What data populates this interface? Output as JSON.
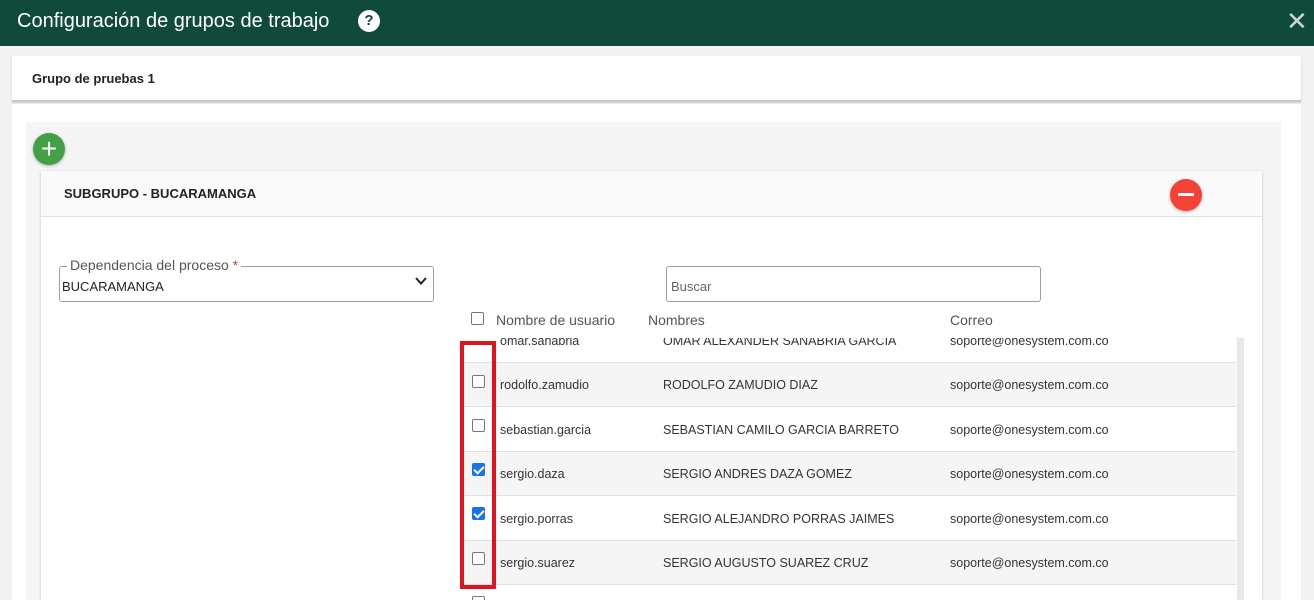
{
  "window": {
    "title": "Configuración de grupos de trabajo",
    "help_glyph": "?",
    "close_glyph": "✕"
  },
  "group": {
    "title": "Grupo de pruebas 1"
  },
  "add_glyph": "+",
  "subgroup": {
    "title": "SUBGRUPO - BUCARAMANGA",
    "dependency": {
      "label": "Dependencia del proceso",
      "required_mark": "*",
      "value": "BUCARAMANGA"
    },
    "search": {
      "placeholder": "Buscar"
    },
    "table": {
      "columns": [
        "Nombre de usuario",
        "Nombres",
        "Correo"
      ],
      "rows": [
        {
          "user": "omar.sanabria",
          "name": "OMAR ALEXANDER SANABRIA GARCIA",
          "email": "soporte@onesystem.com.co",
          "checked": false
        },
        {
          "user": "rodolfo.zamudio",
          "name": "RODOLFO ZAMUDIO DIAZ",
          "email": "soporte@onesystem.com.co",
          "checked": false
        },
        {
          "user": "sebastian.garcia",
          "name": "SEBASTIAN CAMILO GARCIA BARRETO",
          "email": "soporte@onesystem.com.co",
          "checked": false
        },
        {
          "user": "sergio.daza",
          "name": "SERGIO ANDRES DAZA GOMEZ",
          "email": "soporte@onesystem.com.co",
          "checked": true
        },
        {
          "user": "sergio.porras",
          "name": "SERGIO ALEJANDRO PORRAS JAIMES",
          "email": "soporte@onesystem.com.co",
          "checked": true
        },
        {
          "user": "sergio.suarez",
          "name": "SERGIO AUGUSTO SUAREZ CRUZ",
          "email": "soporte@onesystem.com.co",
          "checked": false
        }
      ]
    }
  },
  "colors": {
    "header": "#0f4a3a",
    "add": "#43a047",
    "remove": "#f44336",
    "highlight": "#e0141e",
    "checkbox": "#1a73e8"
  }
}
